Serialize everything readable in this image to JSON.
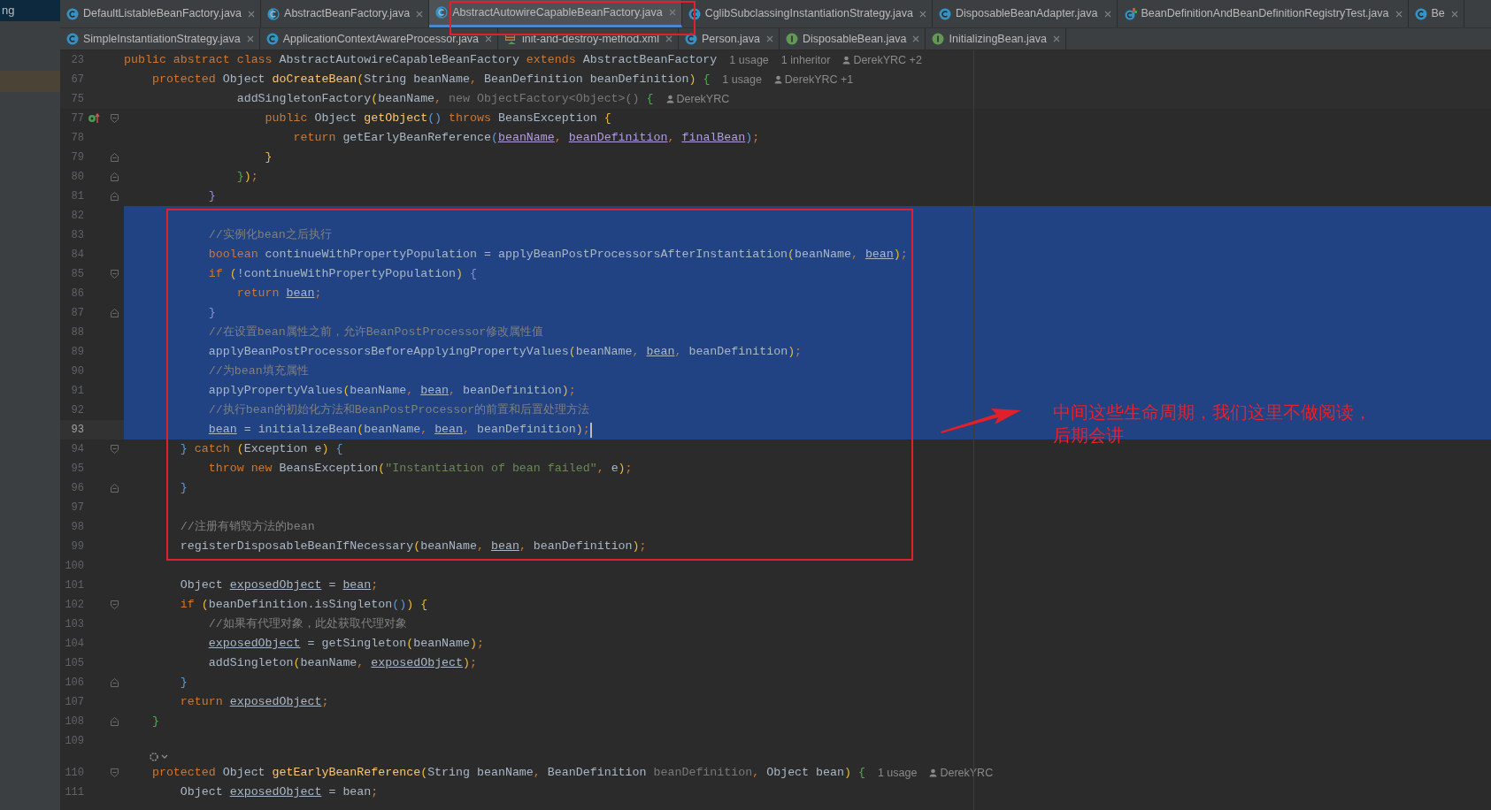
{
  "project_panel": {
    "label": "ng"
  },
  "tabs": [
    [
      {
        "label": "DefaultListableBeanFactory.java",
        "kind": "class",
        "selected": false
      },
      {
        "label": "AbstractBeanFactory.java",
        "kind": "abstract",
        "selected": false
      },
      {
        "label": "AbstractAutowireCapableBeanFactory.java",
        "kind": "abstract",
        "selected": true
      },
      {
        "label": "CglibSubclassingInstantiationStrategy.java",
        "kind": "class",
        "selected": false
      },
      {
        "label": "DisposableBeanAdapter.java",
        "kind": "class",
        "selected": false
      },
      {
        "label": "BeanDefinitionAndBeanDefinitionRegistryTest.java",
        "kind": "test",
        "selected": false
      },
      {
        "label": "Be",
        "kind": "class",
        "selected": false
      }
    ],
    [
      {
        "label": "SimpleInstantiationStrategy.java",
        "kind": "class",
        "selected": false
      },
      {
        "label": "ApplicationContextAwareProcessor.java",
        "kind": "class",
        "selected": false
      },
      {
        "label": "init-and-destroy-method.xml",
        "kind": "xml",
        "selected": false
      },
      {
        "label": "Person.java",
        "kind": "class",
        "selected": false
      },
      {
        "label": "DisposableBean.java",
        "kind": "interface",
        "selected": false
      },
      {
        "label": "InitializingBean.java",
        "kind": "interface",
        "selected": false
      }
    ]
  ],
  "editor": {
    "lines": [
      {
        "kind": "code",
        "number": "23",
        "sticky": true,
        "code": [
          {
            "kind": "kw",
            "text": "public abstract class "
          },
          {
            "kind": "id",
            "text": "AbstractAutowireCapableBeanFactory "
          },
          {
            "kind": "kw",
            "text": "extends "
          },
          {
            "kind": "id",
            "text": "AbstractBeanFactory"
          }
        ],
        "hints": [
          {
            "kind": "usage",
            "text": "1 usage"
          },
          {
            "kind": "usage",
            "text": "1 inheritor"
          },
          {
            "kind": "author",
            "text": "DerekYRC +2"
          }
        ]
      },
      {
        "kind": "code",
        "number": "67",
        "sticky": true,
        "code": [
          {
            "kind": "kw",
            "text": "    protected "
          },
          {
            "kind": "id",
            "text": "Object "
          },
          {
            "kind": "fn",
            "text": "doCreateBean"
          },
          {
            "kind": "py",
            "text": "("
          },
          {
            "kind": "id",
            "text": "String beanName"
          },
          {
            "kind": "kw",
            "text": ", "
          },
          {
            "kind": "id",
            "text": "BeanDefinition beanDefinition"
          },
          {
            "kind": "py",
            "text": ")"
          },
          {
            "kind": "pg",
            "text": " {"
          }
        ],
        "hints": [
          {
            "kind": "usage",
            "text": "1 usage"
          },
          {
            "kind": "author",
            "text": "DerekYRC +1"
          }
        ]
      },
      {
        "kind": "code",
        "number": "75",
        "sticky": true,
        "code": [
          {
            "kind": "id",
            "text": "                addSingletonFactory"
          },
          {
            "kind": "py",
            "text": "("
          },
          {
            "kind": "id",
            "text": "beanName"
          },
          {
            "kind": "kw",
            "text": ", "
          },
          {
            "kind": "dim",
            "text": "new ObjectFactory<Object>() "
          },
          {
            "kind": "pg",
            "text": "{"
          }
        ],
        "hints": [
          {
            "kind": "author",
            "text": "DerekYRC"
          }
        ]
      },
      {
        "kind": "code",
        "number": "77",
        "override": true,
        "fold_start": true,
        "code": [
          {
            "kind": "kw",
            "text": "                    public "
          },
          {
            "kind": "id",
            "text": "Object "
          },
          {
            "kind": "fn",
            "text": "getObject"
          },
          {
            "kind": "pb",
            "text": "()"
          },
          {
            "kind": "kw",
            "text": " throws "
          },
          {
            "kind": "id",
            "text": "BeansException "
          },
          {
            "kind": "py",
            "text": "{"
          }
        ]
      },
      {
        "kind": "code",
        "number": "78",
        "code": [
          {
            "kind": "kw",
            "text": "                        return "
          },
          {
            "kind": "id",
            "text": "getEarlyBeanReference"
          },
          {
            "kind": "pb",
            "text": "("
          },
          {
            "kind": "cap",
            "text": "beanName"
          },
          {
            "kind": "kw",
            "text": ", "
          },
          {
            "kind": "cap",
            "text": "beanDefinition"
          },
          {
            "kind": "kw",
            "text": ", "
          },
          {
            "kind": "cap",
            "text": "finalBean"
          },
          {
            "kind": "pb",
            "text": ")"
          },
          {
            "kind": "kw",
            "text": ";"
          }
        ]
      },
      {
        "kind": "code",
        "number": "79",
        "fold_end": true,
        "code": [
          {
            "kind": "py",
            "text": "                    }"
          }
        ]
      },
      {
        "kind": "code",
        "number": "80",
        "fold_end": true,
        "code": [
          {
            "kind": "pg",
            "text": "                }"
          },
          {
            "kind": "py",
            "text": ")"
          },
          {
            "kind": "kw",
            "text": ";"
          }
        ]
      },
      {
        "kind": "code",
        "number": "81",
        "fold_end": true,
        "code": [
          {
            "kind": "pn",
            "text": "            }"
          }
        ]
      },
      {
        "kind": "code",
        "number": "82",
        "selected": true
      },
      {
        "kind": "code",
        "number": "83",
        "selected": true,
        "code": [
          {
            "kind": "com",
            "text": "            //实例化bean之后执行"
          }
        ]
      },
      {
        "kind": "code",
        "number": "84",
        "selected": true,
        "code": [
          {
            "kind": "kw",
            "text": "            boolean "
          },
          {
            "kind": "id",
            "text": "continueWithPropertyPopulation = applyBeanPostProcessorsAfterInstantiation"
          },
          {
            "kind": "py",
            "text": "("
          },
          {
            "kind": "id",
            "text": "beanName"
          },
          {
            "kind": "kw",
            "text": ", "
          },
          {
            "kind": "ul",
            "text": "bean"
          },
          {
            "kind": "py",
            "text": ")"
          },
          {
            "kind": "kw",
            "text": ";"
          }
        ]
      },
      {
        "kind": "code",
        "number": "85",
        "selected": true,
        "fold_start": true,
        "code": [
          {
            "kind": "kw",
            "text": "            if "
          },
          {
            "kind": "py",
            "text": "("
          },
          {
            "kind": "id",
            "text": "!continueWithPropertyPopulation"
          },
          {
            "kind": "py",
            "text": ")"
          },
          {
            "kind": "pn",
            "text": " {"
          }
        ]
      },
      {
        "kind": "code",
        "number": "86",
        "selected": true,
        "code": [
          {
            "kind": "kw",
            "text": "                return "
          },
          {
            "kind": "ul",
            "text": "bean"
          },
          {
            "kind": "kw",
            "text": ";"
          }
        ]
      },
      {
        "kind": "code",
        "number": "87",
        "selected": true,
        "fold_end": true,
        "code": [
          {
            "kind": "pn",
            "text": "            }"
          }
        ]
      },
      {
        "kind": "code",
        "number": "88",
        "selected": true,
        "code": [
          {
            "kind": "com",
            "text": "            //在设置bean属性之前，允许BeanPostProcessor修改属性值"
          }
        ]
      },
      {
        "kind": "code",
        "number": "89",
        "selected": true,
        "code": [
          {
            "kind": "id",
            "text": "            applyBeanPostProcessorsBeforeApplyingPropertyValues"
          },
          {
            "kind": "py",
            "text": "("
          },
          {
            "kind": "id",
            "text": "beanName"
          },
          {
            "kind": "kw",
            "text": ", "
          },
          {
            "kind": "ul",
            "text": "bean"
          },
          {
            "kind": "kw",
            "text": ", "
          },
          {
            "kind": "id",
            "text": "beanDefinition"
          },
          {
            "kind": "py",
            "text": ")"
          },
          {
            "kind": "kw",
            "text": ";"
          }
        ]
      },
      {
        "kind": "code",
        "number": "90",
        "selected": true,
        "code": [
          {
            "kind": "com",
            "text": "            //为bean填充属性"
          }
        ]
      },
      {
        "kind": "code",
        "number": "91",
        "selected": true,
        "code": [
          {
            "kind": "id",
            "text": "            applyPropertyValues"
          },
          {
            "kind": "py",
            "text": "("
          },
          {
            "kind": "id",
            "text": "beanName"
          },
          {
            "kind": "kw",
            "text": ", "
          },
          {
            "kind": "ul",
            "text": "bean"
          },
          {
            "kind": "kw",
            "text": ", "
          },
          {
            "kind": "id",
            "text": "beanDefinition"
          },
          {
            "kind": "py",
            "text": ")"
          },
          {
            "kind": "kw",
            "text": ";"
          }
        ]
      },
      {
        "kind": "code",
        "number": "92",
        "selected": true,
        "code": [
          {
            "kind": "com",
            "text": "            //执行bean的初始化方法和BeanPostProcessor的前置和后置处理方法"
          }
        ]
      },
      {
        "kind": "code",
        "number": "93",
        "selected": true,
        "current": true,
        "caret": true,
        "code": [
          {
            "kind": "ul",
            "text": "            bean"
          },
          {
            "kind": "id",
            "text": " = initializeBean"
          },
          {
            "kind": "py",
            "text": "("
          },
          {
            "kind": "id",
            "text": "beanName"
          },
          {
            "kind": "kw",
            "text": ", "
          },
          {
            "kind": "ul",
            "text": "bean"
          },
          {
            "kind": "kw",
            "text": ", "
          },
          {
            "kind": "id",
            "text": "beanDefinition"
          },
          {
            "kind": "py",
            "text": ")"
          },
          {
            "kind": "kw",
            "text": ";"
          }
        ]
      },
      {
        "kind": "code",
        "number": "94",
        "fold_start": true,
        "code": [
          {
            "kind": "pb",
            "text": "        }"
          },
          {
            "kind": "kw",
            "text": " catch "
          },
          {
            "kind": "py",
            "text": "("
          },
          {
            "kind": "id",
            "text": "Exception e"
          },
          {
            "kind": "py",
            "text": ")"
          },
          {
            "kind": "pb",
            "text": " {"
          }
        ]
      },
      {
        "kind": "code",
        "number": "95",
        "code": [
          {
            "kind": "kw",
            "text": "            throw new "
          },
          {
            "kind": "id",
            "text": "BeansException"
          },
          {
            "kind": "py",
            "text": "("
          },
          {
            "kind": "str",
            "text": "\"Instantiation of bean failed\""
          },
          {
            "kind": "kw",
            "text": ", "
          },
          {
            "kind": "id",
            "text": "e"
          },
          {
            "kind": "py",
            "text": ")"
          },
          {
            "kind": "kw",
            "text": ";"
          }
        ]
      },
      {
        "kind": "code",
        "number": "96",
        "fold_end": true,
        "code": [
          {
            "kind": "pb",
            "text": "        }"
          }
        ]
      },
      {
        "kind": "code",
        "number": "97"
      },
      {
        "kind": "code",
        "number": "98",
        "code": [
          {
            "kind": "com",
            "text": "        //注册有销毁方法的bean"
          }
        ]
      },
      {
        "kind": "code",
        "number": "99",
        "code": [
          {
            "kind": "id",
            "text": "        registerDisposableBeanIfNecessary"
          },
          {
            "kind": "py",
            "text": "("
          },
          {
            "kind": "id",
            "text": "beanName"
          },
          {
            "kind": "kw",
            "text": ", "
          },
          {
            "kind": "ul",
            "text": "bean"
          },
          {
            "kind": "kw",
            "text": ", "
          },
          {
            "kind": "id",
            "text": "beanDefinition"
          },
          {
            "kind": "py",
            "text": ")"
          },
          {
            "kind": "kw",
            "text": ";"
          }
        ]
      },
      {
        "kind": "code",
        "number": "100"
      },
      {
        "kind": "code",
        "number": "101",
        "code": [
          {
            "kind": "id",
            "text": "        Object "
          },
          {
            "kind": "ul",
            "text": "exposedObject"
          },
          {
            "kind": "id",
            "text": " = "
          },
          {
            "kind": "ul",
            "text": "bean"
          },
          {
            "kind": "kw",
            "text": ";"
          }
        ]
      },
      {
        "kind": "code",
        "number": "102",
        "fold_start": true,
        "code": [
          {
            "kind": "kw",
            "text": "        if "
          },
          {
            "kind": "py",
            "text": "("
          },
          {
            "kind": "id",
            "text": "beanDefinition.isSingleton"
          },
          {
            "kind": "pb",
            "text": "()"
          },
          {
            "kind": "py",
            "text": ")"
          },
          {
            "kind": "py",
            "text": " {"
          }
        ]
      },
      {
        "kind": "code",
        "number": "103",
        "code": [
          {
            "kind": "com",
            "text": "            //如果有代理对象，此处获取代理对象"
          }
        ]
      },
      {
        "kind": "code",
        "number": "104",
        "code": [
          {
            "kind": "ul",
            "text": "            exposedObject"
          },
          {
            "kind": "id",
            "text": " = getSingleton"
          },
          {
            "kind": "py",
            "text": "("
          },
          {
            "kind": "id",
            "text": "beanName"
          },
          {
            "kind": "py",
            "text": ")"
          },
          {
            "kind": "kw",
            "text": ";"
          }
        ]
      },
      {
        "kind": "code",
        "number": "105",
        "code": [
          {
            "kind": "id",
            "text": "            addSingleton"
          },
          {
            "kind": "py",
            "text": "("
          },
          {
            "kind": "id",
            "text": "beanName"
          },
          {
            "kind": "kw",
            "text": ", "
          },
          {
            "kind": "ul",
            "text": "exposedObject"
          },
          {
            "kind": "py",
            "text": ")"
          },
          {
            "kind": "kw",
            "text": ";"
          }
        ]
      },
      {
        "kind": "code",
        "number": "106",
        "fold_end": true,
        "code": [
          {
            "kind": "pb",
            "text": "        }"
          }
        ]
      },
      {
        "kind": "code",
        "number": "107",
        "code": [
          {
            "kind": "kw",
            "text": "        return "
          },
          {
            "kind": "ul",
            "text": "exposedObject"
          },
          {
            "kind": "kw",
            "text": ";"
          }
        ]
      },
      {
        "kind": "code",
        "number": "108",
        "fold_end": true,
        "code": [
          {
            "kind": "pg",
            "text": "    }"
          }
        ]
      },
      {
        "kind": "code",
        "number": "109"
      },
      {
        "kind": "inlay"
      },
      {
        "kind": "code",
        "number": "110",
        "fold_start": true,
        "code": [
          {
            "kind": "kw",
            "text": "    protected "
          },
          {
            "kind": "id",
            "text": "Object "
          },
          {
            "kind": "fn",
            "text": "getEarlyBeanReference"
          },
          {
            "kind": "py",
            "text": "("
          },
          {
            "kind": "id",
            "text": "String beanName"
          },
          {
            "kind": "kw",
            "text": ", "
          },
          {
            "kind": "id",
            "text": "BeanDefinition "
          },
          {
            "kind": "dim",
            "text": "beanDefinition"
          },
          {
            "kind": "kw",
            "text": ", "
          },
          {
            "kind": "id",
            "text": "Object bean"
          },
          {
            "kind": "py",
            "text": ")"
          },
          {
            "kind": "pg",
            "text": " {"
          }
        ],
        "hints": [
          {
            "kind": "usage",
            "text": "1 usage"
          },
          {
            "kind": "author",
            "text": "DerekYRC"
          }
        ]
      },
      {
        "kind": "code",
        "number": "111",
        "code": [
          {
            "kind": "id",
            "text": "        Object "
          },
          {
            "kind": "ul",
            "text": "exposedObject"
          },
          {
            "kind": "id",
            "text": " = bean"
          },
          {
            "kind": "kw",
            "text": ";"
          }
        ]
      }
    ]
  },
  "annotation": {
    "lines": [
      "中间这些生命周期，我们这里不做阅读，",
      "后期会讲"
    ]
  }
}
